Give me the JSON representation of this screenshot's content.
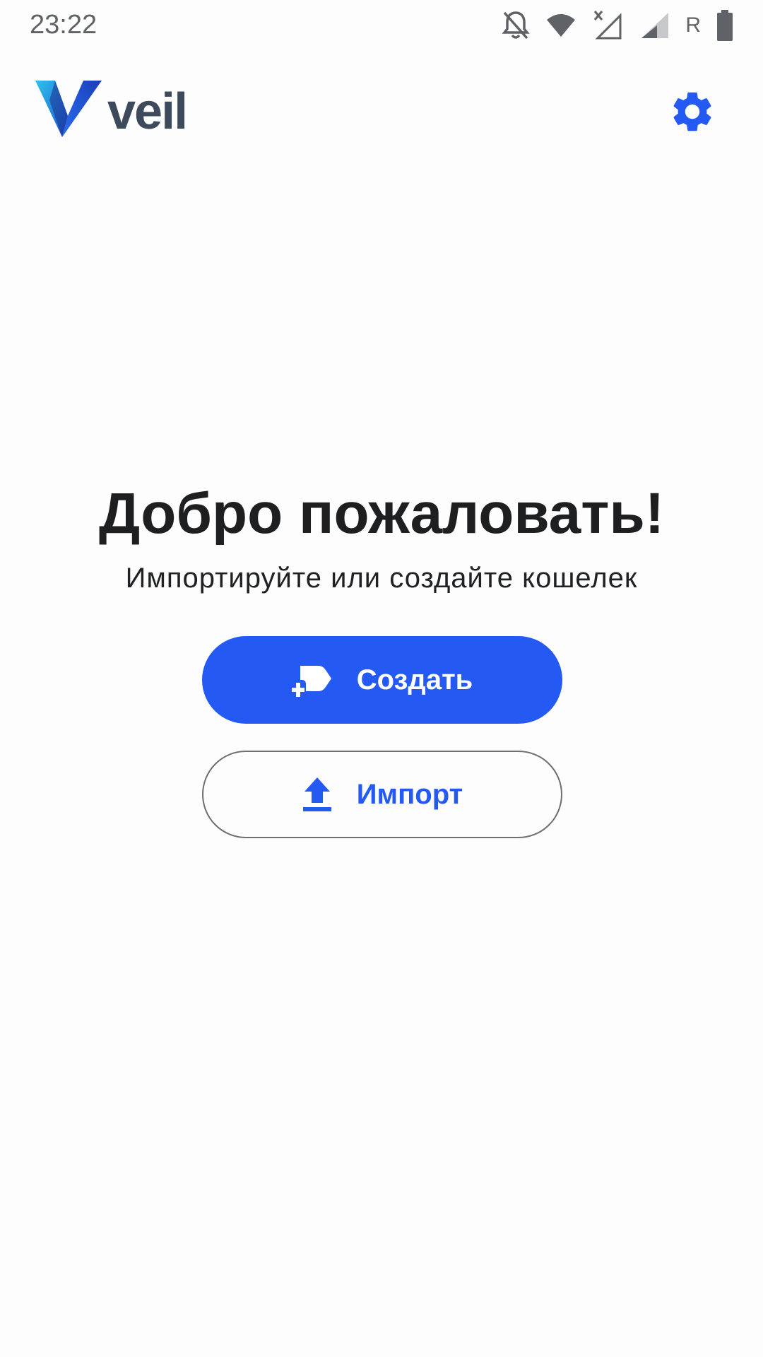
{
  "status_bar": {
    "time": "23:22",
    "icons": [
      "notifications-off-icon",
      "wifi-icon",
      "signal-no-data-icon",
      "signal-icon",
      "roaming-indicator",
      "battery-icon"
    ],
    "roaming_label": "R"
  },
  "header": {
    "logo_text": "veil",
    "settings_icon": "gear-icon"
  },
  "main": {
    "title": "Добро пожаловать!",
    "subtitle": "Импортируйте или создайте кошелек",
    "create_button": {
      "label": "Создать",
      "icon": "add-card-icon"
    },
    "import_button": {
      "label": "Импорт",
      "icon": "upload-icon"
    }
  },
  "colors": {
    "accent": "#2459f4",
    "title_text": "#1e1f21",
    "logo_text": "#3c4a5c",
    "outline": "#6f6f73",
    "background": "#fdfdfd"
  }
}
